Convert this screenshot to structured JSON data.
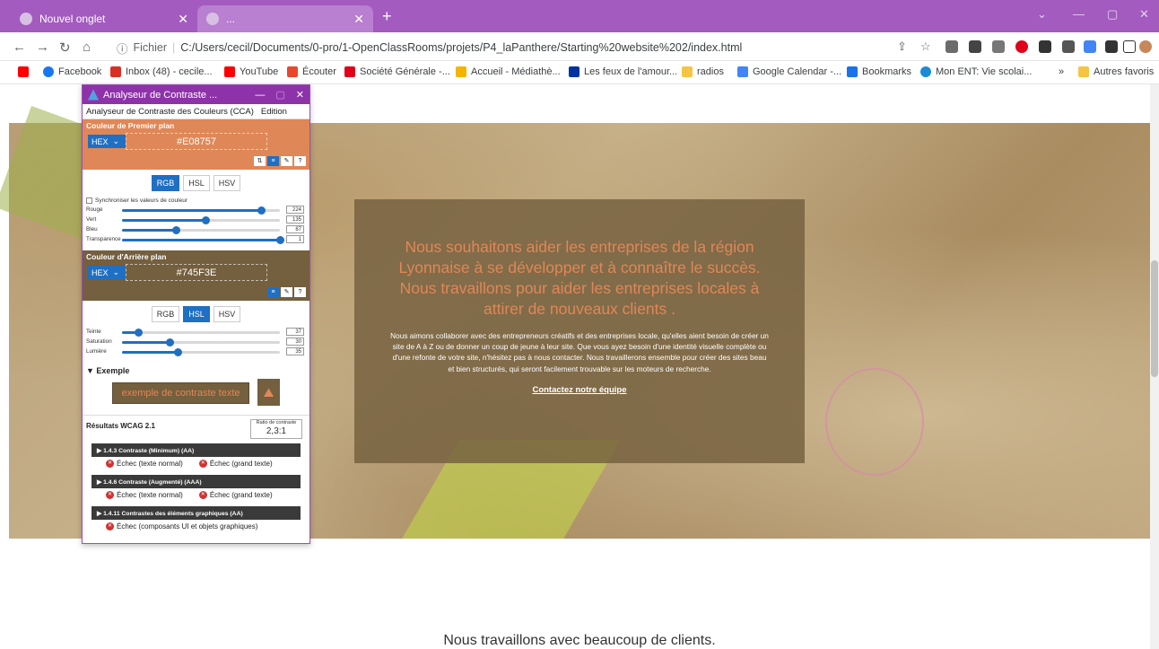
{
  "browser": {
    "tabs": [
      {
        "title": "Nouvel onglet"
      },
      {
        "title": "..."
      }
    ],
    "address": {
      "scheme": "Fichier",
      "url": "C:/Users/cecil/Documents/0-pro/1-OpenClassRooms/projets/P4_laPanthere/Starting%20website%202/index.html"
    },
    "bookmarks": [
      {
        "label": "Facebook",
        "color": "#1877f2"
      },
      {
        "label": "Inbox (48) - cecile...",
        "color": "#d93025"
      },
      {
        "label": "YouTube",
        "color": "#ff0000"
      },
      {
        "label": "Écouter",
        "color": "#e8472b"
      },
      {
        "label": "Société Générale -...",
        "color": "#e2001a"
      },
      {
        "label": "Accueil - Médiathè...",
        "color": "#f4b400"
      },
      {
        "label": "Les feux de l'amour...",
        "color": "#0033a0"
      },
      {
        "label": "radios",
        "color": "#f5c542"
      },
      {
        "label": "Google Calendar -...",
        "color": "#4285f4"
      },
      {
        "label": "Bookmarks",
        "color": "#1a73e8"
      },
      {
        "label": "Mon ENT: Vie scolai...",
        "color": "#1a8bd6"
      }
    ],
    "more_bookmarks": "»",
    "other_favorites": "Autres favoris"
  },
  "cca": {
    "title": "Analyseur de Contraste ...",
    "menu": [
      "Analyseur de Contraste des Couleurs (CCA)",
      "Edition"
    ],
    "foreground": {
      "label": "Couleur de Premier plan",
      "format": "HEX",
      "value": "#E08757",
      "modes": [
        "RGB",
        "HSL",
        "HSV"
      ],
      "active_mode": "RGB",
      "sync_label": "Synchroniser les valeurs de couleur",
      "sliders": [
        {
          "label": "Rouge",
          "value": "224",
          "fraction": 0.878
        },
        {
          "label": "Vert",
          "value": "135",
          "fraction": 0.529
        },
        {
          "label": "Bleu",
          "value": "87",
          "fraction": 0.341
        },
        {
          "label": "Transparence",
          "value": "1",
          "fraction": 1.0
        }
      ]
    },
    "background": {
      "label": "Couleur d'Arrière plan",
      "format": "HEX",
      "value": "#745F3E",
      "modes": [
        "RGB",
        "HSL",
        "HSV"
      ],
      "active_mode": "HSL",
      "sliders": [
        {
          "label": "Teinte",
          "value": "37",
          "fraction": 0.103
        },
        {
          "label": "Saturation",
          "value": "30",
          "fraction": 0.3
        },
        {
          "label": "Lumière",
          "value": "35",
          "fraction": 0.35
        }
      ]
    },
    "example": {
      "label": "▼ Exemple",
      "sample_text": "exemple de contraste texte"
    },
    "results": {
      "title": "Résultats WCAG 2.1",
      "ratio_label": "Ratio de contraste",
      "ratio_value": "2,3:1",
      "criteria": [
        {
          "label": "▶ 1.4.3 Contraste (Minimum) (AA)",
          "fails": [
            "Échec (texte normal)",
            "Échec (grand texte)"
          ]
        },
        {
          "label": "▶ 1.4.6 Contraste (Augmenté) (AAA)",
          "fails": [
            "Échec (texte normal)",
            "Échec (grand texte)"
          ]
        },
        {
          "label": "▶ 1.4.11 Contrastes des éléments graphiques (AA)",
          "fails": [
            "Échec (composants UI et objets graphiques)"
          ]
        }
      ]
    }
  },
  "page": {
    "hero_title": "Nous souhaitons aider les entreprises de la région Lyonnaise à se développer et à connaître le succès. Nous travaillons pour aider les entreprises locales à attirer de nouveaux clients .",
    "hero_text": "Nous aimons collaborer avec des entrepreneurs créatifs et des entreprises locale, qu'elles aient besoin de créer un site de A à Z ou de donner un coup de jeune à leur site. Que vous ayez besoin d'une identité visuelle complète ou d'une refonte de votre site, n'hésitez pas à nous contacter. Nous travaillerons ensemble pour créer des sites beau et bien structurés, qui seront facilement trouvable sur les moteurs de recherche.",
    "hero_link": "Contactez notre équipe",
    "footer_text": "Nous travaillons avec beaucoup de clients."
  }
}
